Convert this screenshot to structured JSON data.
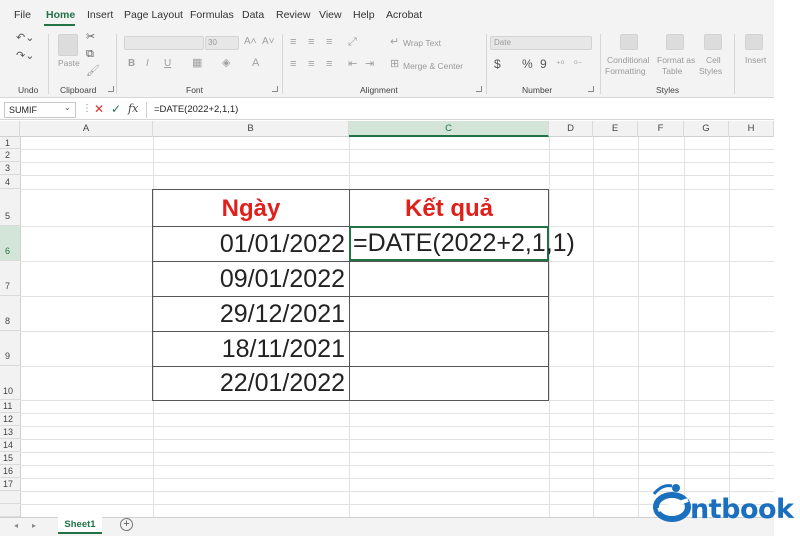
{
  "menu": {
    "items": [
      "File",
      "Home",
      "Insert",
      "Page Layout",
      "Formulas",
      "Data",
      "Review",
      "View",
      "Help",
      "Acrobat"
    ],
    "active": "Home"
  },
  "ribbon": {
    "groups": {
      "undo": "Undo",
      "clipboard": "Clipboard",
      "font": "Font",
      "alignment": "Alignment",
      "number": "Number",
      "styles": "Styles"
    },
    "paste_label": "Paste",
    "font_size": "30",
    "wrap_text": "Wrap Text",
    "merge_center": "Merge & Center",
    "number_format": "Date",
    "conditional_formatting": [
      "Conditional",
      "Formatting"
    ],
    "format_as_table": [
      "Format as",
      "Table"
    ],
    "cell_styles": [
      "Cell",
      "Styles"
    ],
    "insert": "Insert",
    "bold": "B",
    "italic": "I",
    "underline": "U",
    "currency": "$",
    "percent": "%",
    "comma": "9"
  },
  "formula_bar": {
    "name_box": "SUMIF",
    "formula": "=DATE(2022+2,1,1)",
    "fx": "fx"
  },
  "grid": {
    "columns": [
      "A",
      "B",
      "C",
      "D",
      "E",
      "F",
      "G",
      "H"
    ],
    "selected_column": "C",
    "rows": [
      "1",
      "2",
      "3",
      "4",
      "5",
      "6",
      "7",
      "8",
      "9",
      "10",
      "11",
      "12",
      "13",
      "14",
      "15",
      "16",
      "17"
    ],
    "selected_row": "6"
  },
  "table": {
    "header_date": "Ngày",
    "header_result": "Kết quả",
    "dates": [
      "01/01/2022",
      "09/01/2022",
      "29/12/2021",
      "18/11/2021",
      "22/01/2022"
    ],
    "active_formula": "=DATE(2022+2,1,1)"
  },
  "sheets": {
    "active": "Sheet1"
  },
  "logo": {
    "text": "ntbook"
  },
  "colors": {
    "accent": "#217346",
    "header_text": "#e0201b",
    "logo": "#1a6fbf"
  }
}
